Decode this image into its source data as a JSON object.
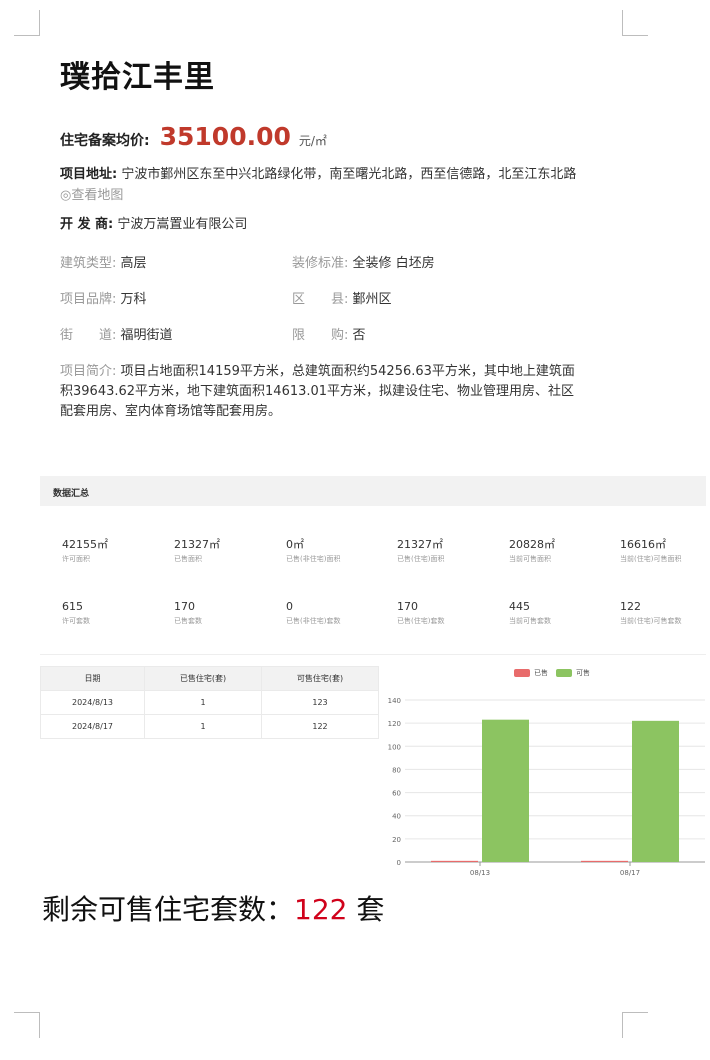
{
  "project": {
    "name": "璞拾江丰里",
    "price_label": "住宅备案均价:",
    "price_value": "35100.00",
    "price_unit": "元/㎡",
    "address_label": "项目地址:",
    "address": "宁波市鄞州区东至中兴北路绿化带，南至曙光北路，西至信德路，北至江东北路",
    "map_link": "◎查看地图",
    "developer_label": "开 发 商:",
    "developer": "宁波万嵩置业有限公司",
    "attributes": [
      {
        "key": "建筑类型:",
        "value": "高层"
      },
      {
        "key": "装修标准:",
        "value": "全装修 白坯房"
      },
      {
        "key": "项目品牌:",
        "value": "万科"
      },
      {
        "key": "区　　县:",
        "value": "鄞州区"
      },
      {
        "key": "街　　道:",
        "value": "福明街道"
      },
      {
        "key": "限　　购:",
        "value": "否"
      }
    ],
    "intro_label": "项目简介:",
    "intro": "项目占地面积14159平方米，总建筑面积约54256.63平方米，其中地上建筑面积39643.62平方米，地下建筑面积14613.01平方米，拟建设住宅、物业管理用房、社区配套用房、室内体育场馆等配套用房。"
  },
  "summary": {
    "title": "数据汇总",
    "stats": [
      {
        "value": "42155㎡",
        "label": "许可面积"
      },
      {
        "value": "21327㎡",
        "label": "已售面积"
      },
      {
        "value": "0㎡",
        "label": "已售(非住宅)面积"
      },
      {
        "value": "21327㎡",
        "label": "已售(住宅)面积"
      },
      {
        "value": "20828㎡",
        "label": "当前可售面积"
      },
      {
        "value": "16616㎡",
        "label": "当前(住宅)可售面积"
      },
      {
        "value": "615",
        "label": "许可套数"
      },
      {
        "value": "170",
        "label": "已售套数"
      },
      {
        "value": "0",
        "label": "已售(非住宅)套数"
      },
      {
        "value": "170",
        "label": "已售(住宅)套数"
      },
      {
        "value": "445",
        "label": "当前可售套数"
      },
      {
        "value": "122",
        "label": "当前(住宅)可售套数"
      }
    ]
  },
  "table": {
    "headers": [
      "日期",
      "已售住宅(套)",
      "可售住宅(套)"
    ],
    "rows": [
      [
        "2024/8/13",
        "1",
        "123"
      ],
      [
        "2024/8/17",
        "1",
        "122"
      ]
    ]
  },
  "chart_data": {
    "type": "bar",
    "categories": [
      "08/13",
      "08/17"
    ],
    "series": [
      {
        "name": "已售",
        "values": [
          1,
          1
        ],
        "color": "#e86b6b"
      },
      {
        "name": "可售",
        "values": [
          123,
          122
        ],
        "color": "#8cc461"
      }
    ],
    "ylim": [
      0,
      140
    ],
    "yticks": [
      0,
      20,
      40,
      60,
      80,
      100,
      120,
      140
    ],
    "grid": true,
    "legend": "top"
  },
  "footer": {
    "prefix": "剩余可售住宅套数：",
    "count": "122",
    "suffix": " 套"
  }
}
